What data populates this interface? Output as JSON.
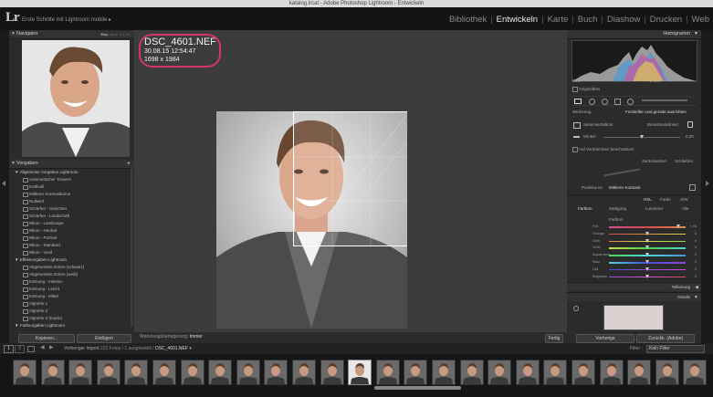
{
  "window": {
    "title": "katalog.lrcat - Adobe Photoshop Lightroom - Entwickeln"
  },
  "topbar": {
    "logo": "Lr",
    "identity": "Erste Schritte mit Lightroom mobile",
    "identity_arrow": "▸",
    "modules": [
      "Bibliothek",
      "Entwickeln",
      "Karte",
      "Buch",
      "Diashow",
      "Drucken",
      "Web"
    ],
    "active_module": "Entwickeln"
  },
  "left_panel": {
    "navigator": {
      "title": "Navigator",
      "options": [
        "Einp.",
        "Ausf.",
        "1:1",
        "3:1"
      ]
    },
    "presets": {
      "title": "Vorgaben",
      "add": "+",
      "items": [
        {
          "type": "folder",
          "label": "Allgemeine Vorgaben Lightroom"
        },
        {
          "type": "item",
          "label": "Automatischer Tonwert"
        },
        {
          "type": "item",
          "label": "Kraftvoll"
        },
        {
          "type": "item",
          "label": "Mittlerer Kontrastkurve"
        },
        {
          "type": "item",
          "label": "Nullwert"
        },
        {
          "type": "item",
          "label": "Schärfen - Gesichter"
        },
        {
          "type": "item",
          "label": "Schärfen - Landschaft"
        },
        {
          "type": "item",
          "label": "Nikon - Landscape"
        },
        {
          "type": "item",
          "label": "Nikon - Neutral"
        },
        {
          "type": "item",
          "label": "Nikon - Portrait"
        },
        {
          "type": "item",
          "label": "Nikon - Standard"
        },
        {
          "type": "item",
          "label": "Nikon - Vivid"
        },
        {
          "type": "folder",
          "label": "Effektvorgaben Lightroom"
        },
        {
          "type": "item",
          "label": "Abgerundete Ecken (schwarz)"
        },
        {
          "type": "item",
          "label": "Abgerundete Ecken (weiß)"
        },
        {
          "type": "item",
          "label": "Körnung - Intensiv"
        },
        {
          "type": "item",
          "label": "Körnung - Leicht"
        },
        {
          "type": "item",
          "label": "Körnung - Mittel"
        },
        {
          "type": "item",
          "label": "Vignette 1"
        },
        {
          "type": "item",
          "label": "Vignette 2"
        },
        {
          "type": "item",
          "label": "Vignette 2 (Kopie)"
        },
        {
          "type": "folder",
          "label": "Farbvorgaben Lightroom"
        }
      ]
    },
    "buttons": {
      "copy": "Kopieren...",
      "paste": "Einfügen"
    }
  },
  "center": {
    "info": {
      "filename": "DSC_4601.NEF",
      "datetime": "30.08.15 12:54:47",
      "dimensions": "1698 x 1984"
    },
    "toolbar": {
      "label": "Werkzeugüberlagerung:",
      "value": "Immer",
      "done": "Fertig"
    }
  },
  "right_panel": {
    "histogram": {
      "title": "Histogramm",
      "readout_left": "f/8.0",
      "readout_right": "1/ 1,4"
    },
    "original_photo_label": "Originalfoto",
    "crop": {
      "tool_label": "Werkzeug:",
      "tool_value": "Freistellen und gerade ausrichten",
      "aspect_label": "Seitenverhältnis:",
      "aspect_value": "Benutzerdefiniert",
      "angle_label": "Winkel",
      "angle_value": "0,00",
      "constrain_label": "Auf Verkrümmen beschränken",
      "reset": "Zurücksetzen",
      "close": "Schließen"
    },
    "point_curve": {
      "label": "Punktkurve:",
      "value": "Mittlerer Kontrast"
    },
    "hsl": {
      "tabs": [
        "HSL",
        "Farbe",
        "S/W"
      ],
      "subtabs": [
        "Farbton",
        "Sättigung",
        "Luminanz",
        "Alle"
      ],
      "section": "Farbton",
      "rows": [
        {
          "label": "Rot",
          "value": "+ 45",
          "knob": 0.9
        },
        {
          "label": "Orange",
          "value": "0",
          "knob": 0.5
        },
        {
          "label": "Gelb",
          "value": "0",
          "knob": 0.5
        },
        {
          "label": "Grün",
          "value": "0",
          "knob": 0.5
        },
        {
          "label": "Aquamarin",
          "value": "0",
          "knob": 0.5
        },
        {
          "label": "Blau",
          "value": "0",
          "knob": 0.5
        },
        {
          "label": "Lila",
          "value": "0",
          "knob": 0.5
        },
        {
          "label": "Magenta",
          "value": "0",
          "knob": 0.5
        }
      ]
    },
    "split_toning": "Teiltonung",
    "details": "Details",
    "buttons": {
      "previous": "Vorherige",
      "reset": "Zurückk. (Adobe)"
    }
  },
  "filter_bar": {
    "page1": "1",
    "page2": "2",
    "source": "Vorheriger Import",
    "count": "232 Fotos / 1 ausgewählt /",
    "selected_file": "DSC_4601.NEF",
    "filter_label": "Filter :",
    "filter_value": "Kein Filter"
  },
  "colors": {
    "annotation": "#d6336c",
    "active_module": "#ececec"
  }
}
